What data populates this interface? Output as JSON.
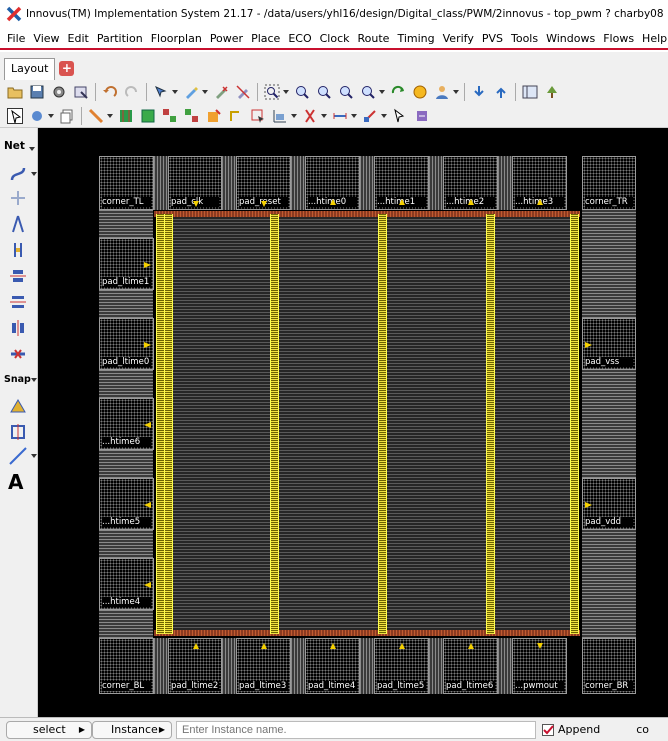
{
  "window": {
    "title": "Innovus(TM) Implementation System 21.17 - /data/users/yhl16/design/Digital_class/PWM/2innovus - top_pwm ? charby08"
  },
  "menu": [
    "File",
    "View",
    "Edit",
    "Partition",
    "Floorplan",
    "Power",
    "Place",
    "ECO",
    "Clock",
    "Route",
    "Timing",
    "Verify",
    "PVS",
    "Tools",
    "Windows",
    "Flows",
    "Help"
  ],
  "tabs": {
    "layout": "Layout",
    "add_icon": "plus-icon"
  },
  "left_toolbar": {
    "net_label": "Net",
    "snap_label": "Snap",
    "text_tool": "A"
  },
  "pads": {
    "top": [
      "corner_TL",
      "pad_clk",
      "pad_reset",
      "...htime0",
      "...htime1",
      "...htime2",
      "...htime3",
      "corner_TR"
    ],
    "left": [
      "pad_ltime1",
      "pad_ltime0",
      "...htime6",
      "...htime5",
      "...htime4"
    ],
    "right": [
      "pad_vss",
      "pad_vdd"
    ],
    "bottom": [
      "corner_BL",
      "pad_ltime2",
      "pad_ltime3",
      "pad_ltime4",
      "pad_ltime5",
      "pad_ltime6",
      "...pwmout",
      "corner_BR"
    ]
  },
  "statusbar": {
    "select_btn": "select",
    "instance_btn": "Instance",
    "instance_placeholder": "Enter Instance name.",
    "append_label": "Append",
    "append_checked": true,
    "trailing": "co"
  },
  "colors": {
    "power_stripe": "#f0e040",
    "core_ring": "#b04a28",
    "canvas": "#000000",
    "menu_underline": "#c8102e"
  }
}
